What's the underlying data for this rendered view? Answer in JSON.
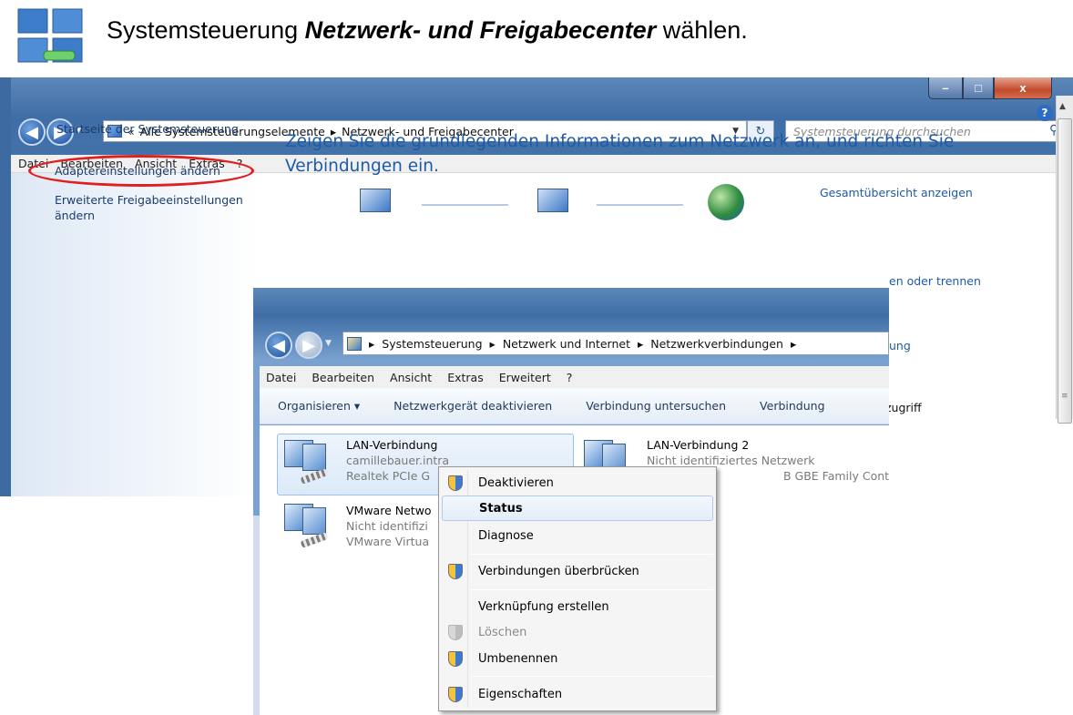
{
  "header": {
    "text_before": "Systemsteuerung ",
    "text_bold": "Netzwerk- und Freigabecenter",
    "text_after": " wählen."
  },
  "window1": {
    "caption_buttons": {
      "minimize": "–",
      "maximize": "□",
      "close": "x"
    },
    "address": {
      "overflow": "«",
      "crumb1": "Alle Systemsteuerungselemente",
      "sep": "▸",
      "crumb2": "Netzwerk- und Freigabecenter"
    },
    "search_placeholder": "Systemsteuerung durchsuchen",
    "menu": [
      "Datei",
      "Bearbeiten",
      "Ansicht",
      "Extras",
      "?"
    ],
    "sidebar": {
      "home": "Startseite der Systemsteuerung",
      "adapter": "Adaptereinstellungen ändern",
      "advanced": "Erweiterte Freigabeeinstellungen ändern"
    },
    "heading": "Zeigen Sie die grundlegenden Informationen zum Netzwerk an, und richten Sie Verbindungen ein.",
    "overview_link": "Gesamtübersicht anzeigen",
    "fragment1": "en oder trennen",
    "fragment2": "ung",
    "fragment3": "zugriff",
    "help": "?"
  },
  "window2": {
    "address": {
      "sep": "▸",
      "crumb1": "Systemsteuerung",
      "crumb2": "Netzwerk und Internet",
      "crumb3": "Netzwerkverbindungen"
    },
    "menu": [
      "Datei",
      "Bearbeiten",
      "Ansicht",
      "Extras",
      "Erweitert",
      "?"
    ],
    "toolbar": {
      "organize": "Organisieren ▾",
      "disable": "Netzwerkgerät deaktivieren",
      "diagnose": "Verbindung untersuchen",
      "rename": "Verbindung"
    },
    "connections": [
      {
        "name": "LAN-Verbindung",
        "network": "camillebauer.intra",
        "device": "Realtek PCIe G"
      },
      {
        "name": "LAN-Verbindung 2",
        "network": "Nicht identifiziertes Netzwerk",
        "device": "B GBE Family Controller"
      },
      {
        "name": "VMware Netwo",
        "network": "Nicht identifizi",
        "device": "VMware Virtua"
      }
    ]
  },
  "context_menu": {
    "items": [
      {
        "label": "Deaktivieren",
        "icon": "uac-shield-icon"
      },
      {
        "label": "Status",
        "icon": ""
      },
      {
        "label": "Diagnose",
        "icon": ""
      },
      {
        "label": "Verbindungen überbrücken",
        "icon": "uac-shield-icon"
      },
      {
        "label": "Verknüpfung erstellen",
        "icon": ""
      },
      {
        "label": "Löschen",
        "icon": "uac-shield-icon"
      },
      {
        "label": "Umbenennen",
        "icon": "uac-shield-icon"
      },
      {
        "label": "Eigenschaften",
        "icon": "uac-shield-icon"
      }
    ],
    "selected": "Status",
    "disabled": "Löschen"
  },
  "colors": {
    "link": "#1e5aa8",
    "highlight_ellipse": "#e01f1f",
    "title_gradient": "#3f6ea6"
  }
}
